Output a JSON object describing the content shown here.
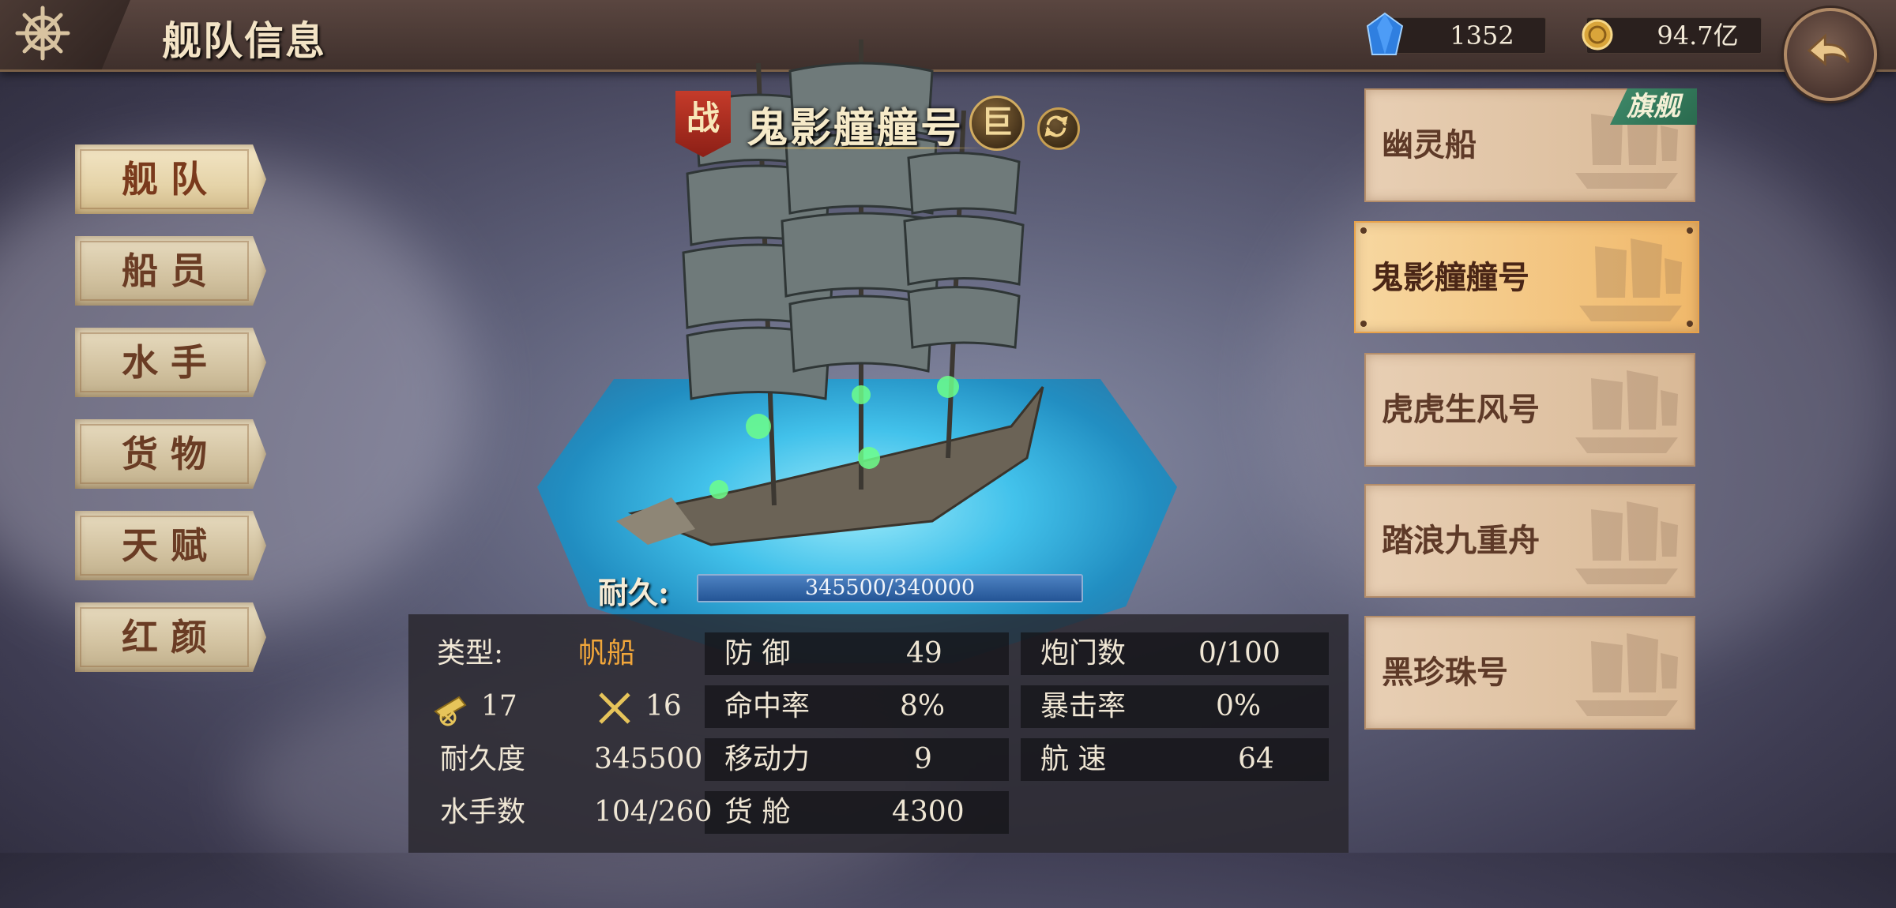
{
  "header": {
    "title": "舰队信息",
    "gems": "1352",
    "gold": "94.7亿"
  },
  "menu": {
    "items": [
      {
        "label": "舰队",
        "active": true
      },
      {
        "label": "船员",
        "active": false
      },
      {
        "label": "水手",
        "active": false
      },
      {
        "label": "货物",
        "active": false
      },
      {
        "label": "天赋",
        "active": false
      },
      {
        "label": "红颜",
        "active": false
      }
    ]
  },
  "ship": {
    "badge": "战",
    "name": "鬼影艟艟号",
    "size_badge": "巨",
    "durability_label": "耐久:",
    "durability_text": "345500/340000",
    "durability_fraction": 1.0
  },
  "stats": {
    "type_label": "类型:",
    "type_value": "帆船",
    "cannon_value": "17",
    "melee_value": "16",
    "durability_label": "耐久度",
    "durability_value": "345500",
    "sailors_label": "水手数",
    "sailors_value": "104/260",
    "defense_label": "防 御",
    "defense_value": "49",
    "hit_label": "命中率",
    "hit_value": "8%",
    "move_label": "移动力",
    "move_value": "9",
    "cargo_label": "货 舱",
    "cargo_value": "4300",
    "gun_ports_label": "炮门数",
    "gun_ports_value": "0/100",
    "crit_label": "暴击率",
    "crit_value": "0%",
    "speed_label": "航 速",
    "speed_value": "64"
  },
  "ship_list": {
    "flagship_tag": "旗舰",
    "items": [
      {
        "label": "幽灵船",
        "flagship": true,
        "selected": false
      },
      {
        "label": "鬼影艟艟号",
        "flagship": false,
        "selected": true
      },
      {
        "label": "虎虎生风号",
        "flagship": false,
        "selected": false
      },
      {
        "label": "踏浪九重舟",
        "flagship": false,
        "selected": false
      },
      {
        "label": "黑珍珠号",
        "flagship": false,
        "selected": false
      }
    ]
  },
  "colors": {
    "accent_orange": "#f1a63a",
    "selected_item": "#f0b86a",
    "flag_green": "#3f8a6a",
    "war_red": "#c53b2a"
  }
}
